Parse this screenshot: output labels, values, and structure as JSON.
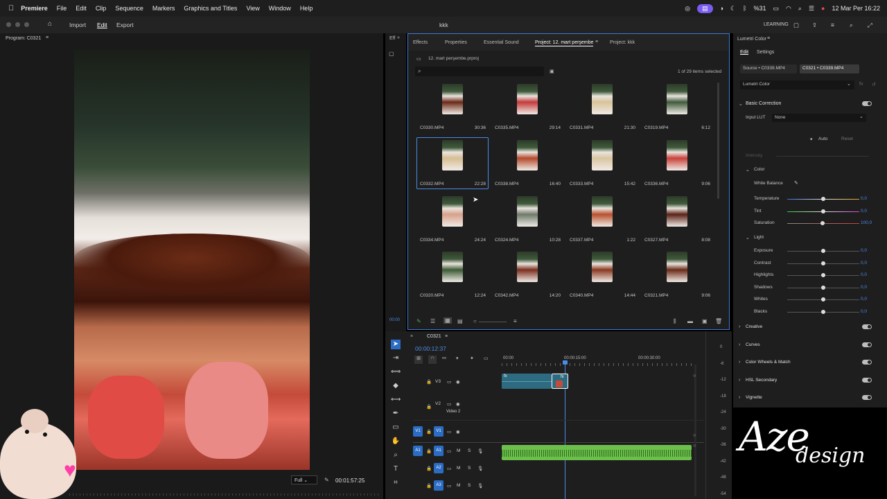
{
  "menubar": {
    "app": "Premiere",
    "items": [
      "File",
      "Edit",
      "Clip",
      "Sequence",
      "Markers",
      "Graphics and Titles",
      "View",
      "Window",
      "Help"
    ],
    "battery": "%31",
    "datetime": "12 Mar Per  16:22"
  },
  "header": {
    "tabs": [
      "Import",
      "Edit",
      "Export"
    ],
    "title": "kkk",
    "workspace": "LEARNING"
  },
  "program": {
    "label": "Program: C0321",
    "zoom": "Full",
    "timecode": "00:01:57:25"
  },
  "left_strip": {
    "label": "Eff",
    "time": "00:00"
  },
  "project": {
    "tabs": [
      "Effects",
      "Properties",
      "Essential Sound",
      "Project: 12. mart perşembe",
      "Project: kkk"
    ],
    "file": "12. mart perşembe.prproj",
    "selection": "1 of 29 items selected",
    "clips": [
      {
        "name": "C0330.MP4",
        "dur": "30:36",
        "tone": "#6a2a18"
      },
      {
        "name": "C0335.MP4",
        "dur": "29:14",
        "tone": "#c43a3a"
      },
      {
        "name": "C0331.MP4",
        "dur": "21:30",
        "tone": "#d8c39a"
      },
      {
        "name": "C0319.MP4",
        "dur": "6:12",
        "tone": "#3f5a3a"
      },
      {
        "name": "C0332.MP4",
        "dur": "22:28",
        "tone": "#d6bd92"
      },
      {
        "name": "C0338.MP4",
        "dur": "16:40",
        "tone": "#b3492c"
      },
      {
        "name": "C0333.MP4",
        "dur": "15:42",
        "tone": "#d9c5a0"
      },
      {
        "name": "C0336.MP4",
        "dur": "9:06",
        "tone": "#c8413a"
      },
      {
        "name": "C0334.MP4",
        "dur": "24:24",
        "tone": "#d7a08a"
      },
      {
        "name": "C0324.MP4",
        "dur": "10:28",
        "tone": "#6f7a6a"
      },
      {
        "name": "C0337.MP4",
        "dur": "1:22",
        "tone": "#b8502e"
      },
      {
        "name": "C0327.MP4",
        "dur": "8:08",
        "tone": "#5a2216"
      },
      {
        "name": "C0320.MP4",
        "dur": "12:24",
        "tone": "#3b5a34"
      },
      {
        "name": "C0342.MP4",
        "dur": "14:20",
        "tone": "#7a2f1e"
      },
      {
        "name": "C0340.MP4",
        "dur": "14:44",
        "tone": "#8a3820"
      },
      {
        "name": "C0321.MP4",
        "dur": "9:06",
        "tone": "#6a2a18"
      }
    ]
  },
  "timeline": {
    "seq": "C0321",
    "timecode": "00:00:12:37",
    "ruler": [
      "00:00",
      "00:00:15:00",
      "00:00:30:00"
    ],
    "tracks": [
      {
        "id": "V3",
        "label": ""
      },
      {
        "id": "V2",
        "label": "Video 2"
      },
      {
        "id": "V1",
        "label": ""
      },
      {
        "id": "A1",
        "label": ""
      },
      {
        "id": "A2",
        "label": ""
      },
      {
        "id": "A3",
        "label": ""
      }
    ],
    "meter": [
      "0",
      "-6",
      "-12",
      "-18",
      "-24",
      "-30",
      "-36",
      "-42",
      "-48",
      "-54"
    ]
  },
  "lumetri": {
    "panel_title": "Lumetri Color",
    "tabs": [
      "Edit",
      "Settings"
    ],
    "source": "Source • C0339.MP4",
    "target": "C0321 • C0339.MP4",
    "effect": "Lumetri Color",
    "basic": "Basic Correction",
    "input_lut_label": "Input LUT",
    "input_lut": "None",
    "auto": "Auto",
    "reset": "Reset",
    "intensity": "Intensity",
    "color_section": "Color",
    "white_balance": "White Balance",
    "color_sliders": [
      {
        "label": "Temperature",
        "value": "0,0"
      },
      {
        "label": "Tint",
        "value": "0,0"
      },
      {
        "label": "Saturation",
        "value": "100,0"
      }
    ],
    "light_section": "Light",
    "light_sliders": [
      {
        "label": "Exposure",
        "value": "0,0"
      },
      {
        "label": "Contrast",
        "value": "0,0"
      },
      {
        "label": "Highlights",
        "value": "0,0"
      },
      {
        "label": "Shadows",
        "value": "0,0"
      },
      {
        "label": "Whites",
        "value": "0,0"
      },
      {
        "label": "Blacks",
        "value": "0,0"
      }
    ],
    "sections": [
      "Creative",
      "Curves",
      "Color Wheels & Match",
      "HSL Secondary",
      "Vignette"
    ]
  },
  "watermark": {
    "text1": "Aze",
    "text2": "design"
  }
}
